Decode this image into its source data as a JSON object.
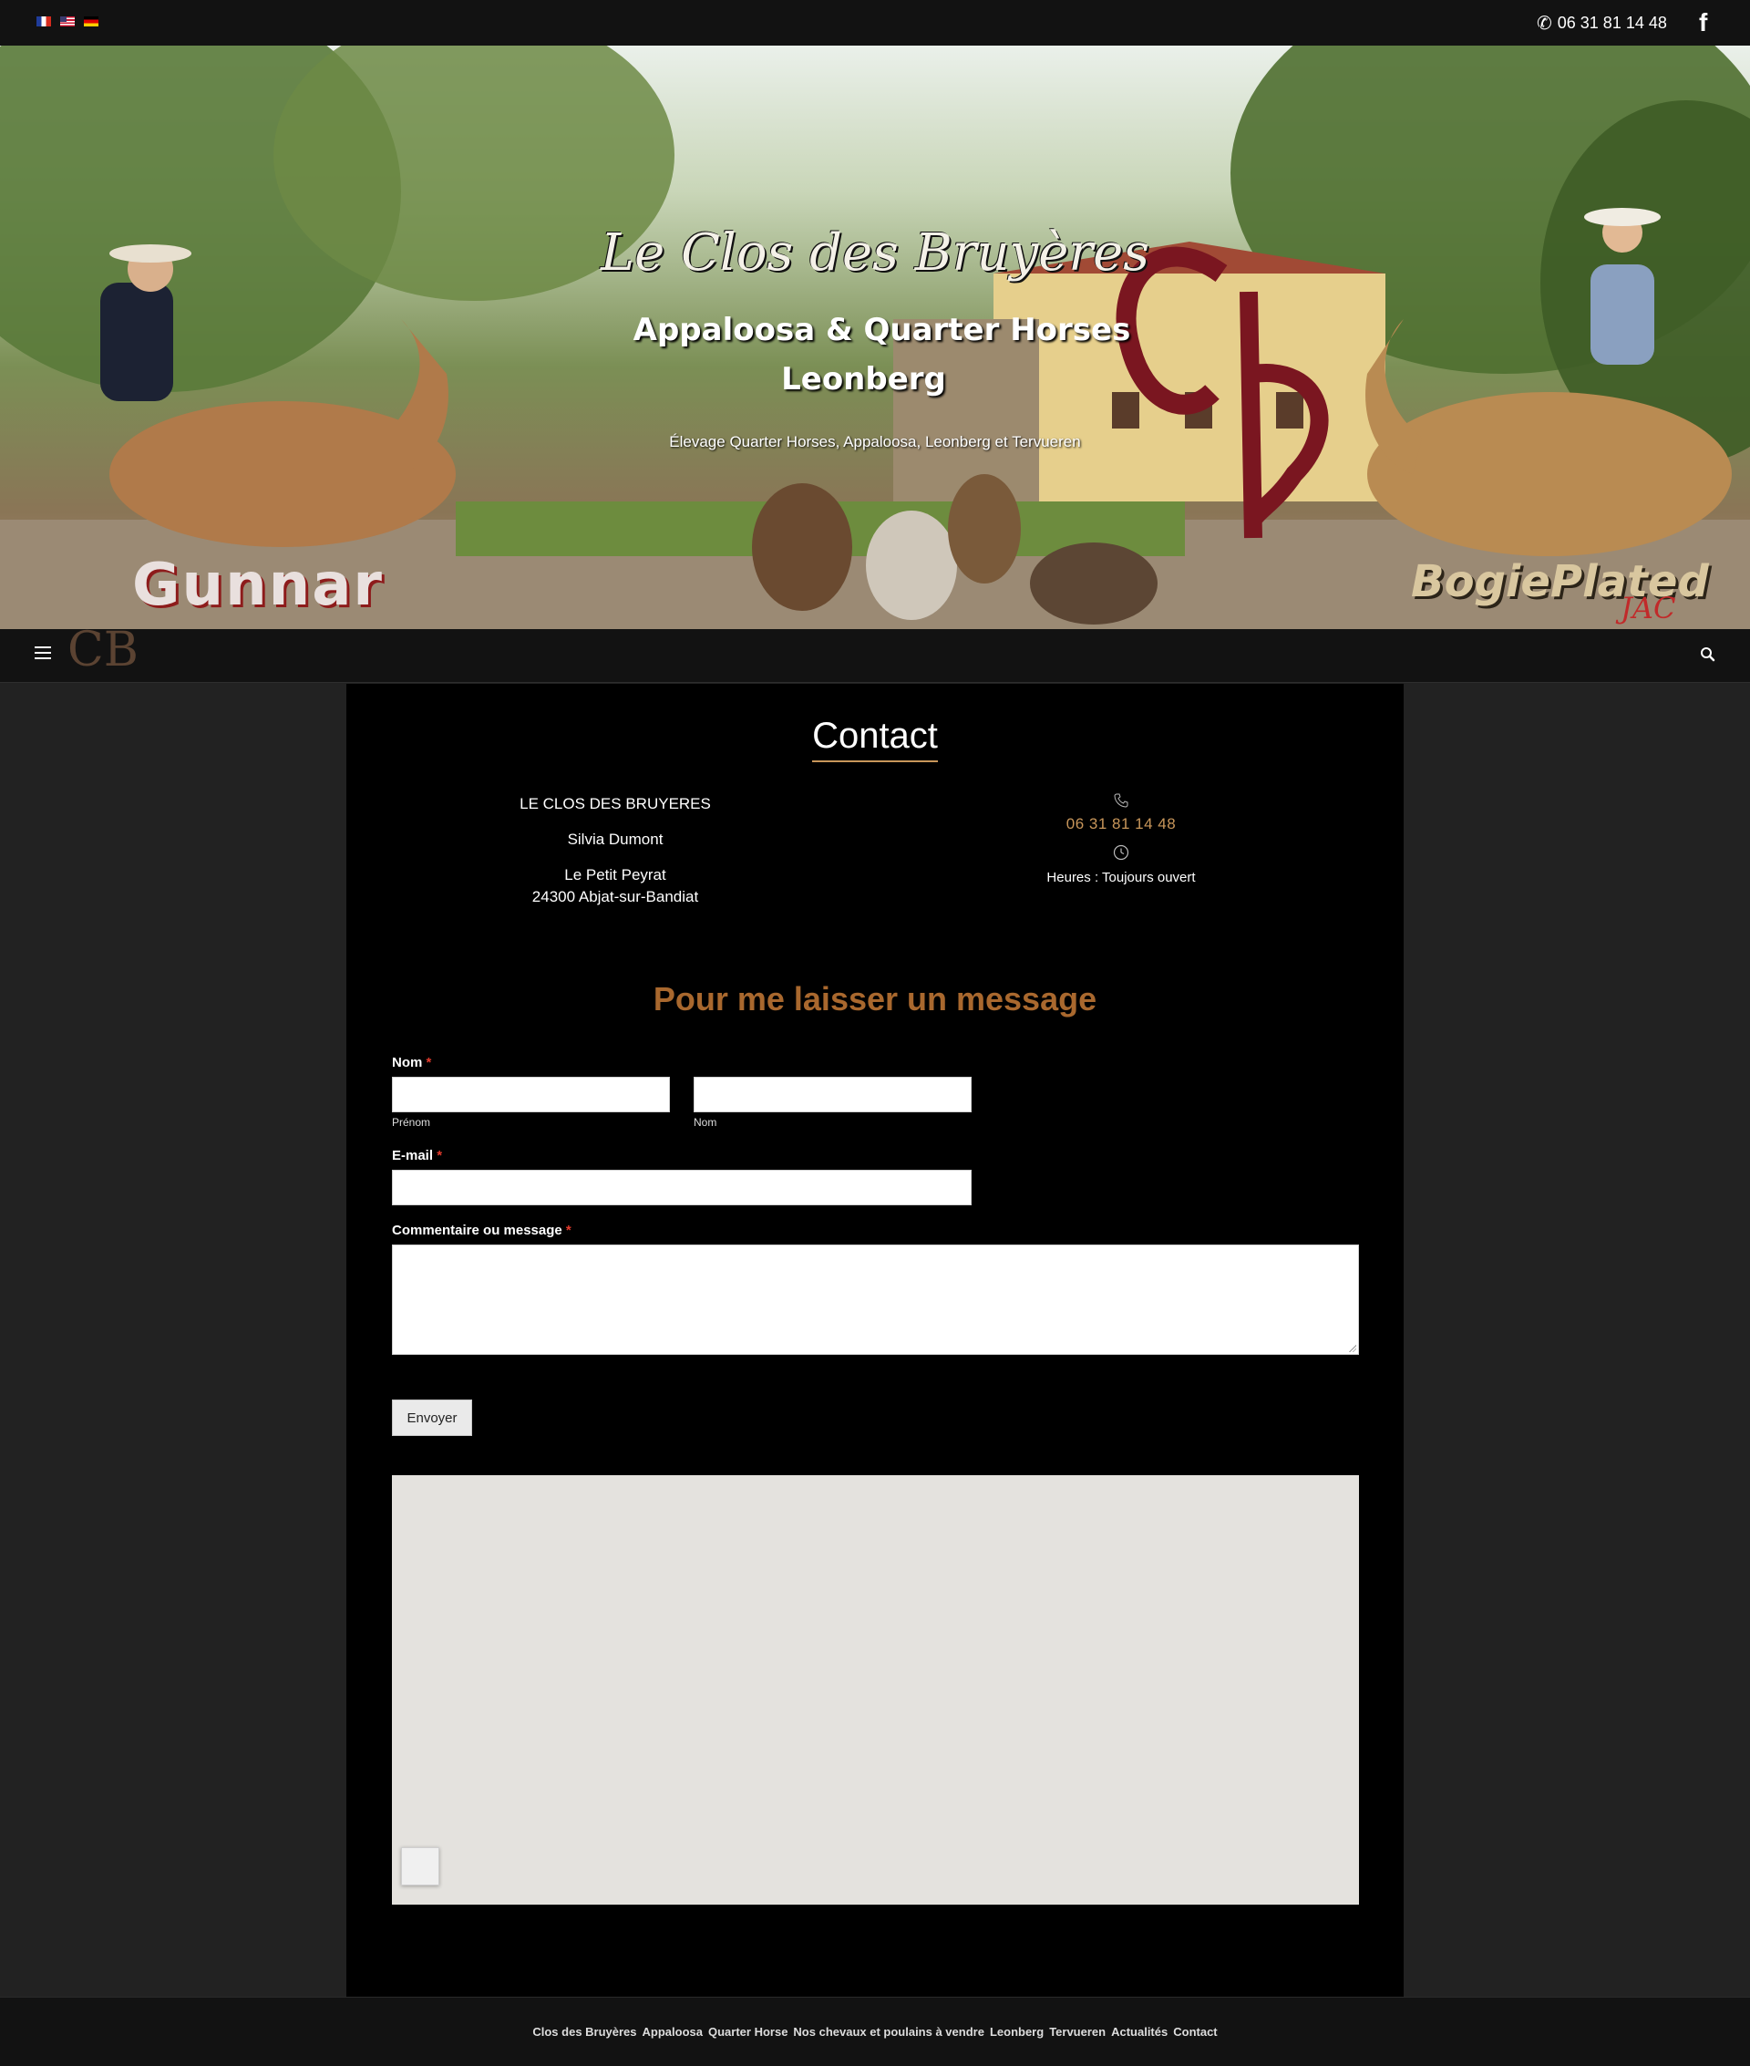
{
  "topbar": {
    "languages": [
      "Français",
      "English",
      "Deutsch"
    ],
    "phone": "06 31 81 14 48",
    "social_icon": "facebook-icon"
  },
  "hero": {
    "title": "Le Clos des Bruyères",
    "subtitle_line1": "Appaloosa & Quarter Horses",
    "subtitle_line2": "Leonberg",
    "tagline": "Élevage Quarter Horses, Appaloosa, Leonberg et Tervueren",
    "logo_left": "Gunnar",
    "logo_right": "BogiePlated",
    "logo_right_sub": "JAC",
    "logo_monogram": "CB"
  },
  "nav": {
    "menu_icon": "hamburger-menu-icon",
    "logo": "CB",
    "search_icon": "search-icon"
  },
  "contact": {
    "title": "Contact",
    "company": "LE CLOS DES BRUYERES",
    "person": "Silvia Dumont",
    "address_line1": "Le Petit Peyrat",
    "address_line2": "24300 Abjat-sur-Bandiat",
    "phone_icon": "phone-icon",
    "phone": "06 31 81 14 48",
    "clock_icon": "clock-icon",
    "hours": "Heures : Toujours ouvert"
  },
  "form": {
    "title": "Pour me laisser un message",
    "name_label": "Nom",
    "required_mark": "*",
    "first_name_value": "",
    "first_name_sublabel": "Prénom",
    "last_name_value": "",
    "last_name_sublabel": "Nom",
    "email_label": "E-mail",
    "email_value": "",
    "message_label": "Commentaire ou message",
    "message_value": "",
    "submit_label": "Envoyer"
  },
  "footer": {
    "links": [
      "Clos des Bruyères",
      "Appaloosa",
      "Quarter Horse",
      "Nos chevaux et poulains à vendre",
      "Leonberg",
      "Tervueren",
      "Actualités",
      "Contact"
    ]
  },
  "colors": {
    "accent": "#c8965a",
    "heading_brown": "#a9682e",
    "required_red": "#e33a2c",
    "page_bg": "#222222",
    "content_bg": "#000000"
  }
}
